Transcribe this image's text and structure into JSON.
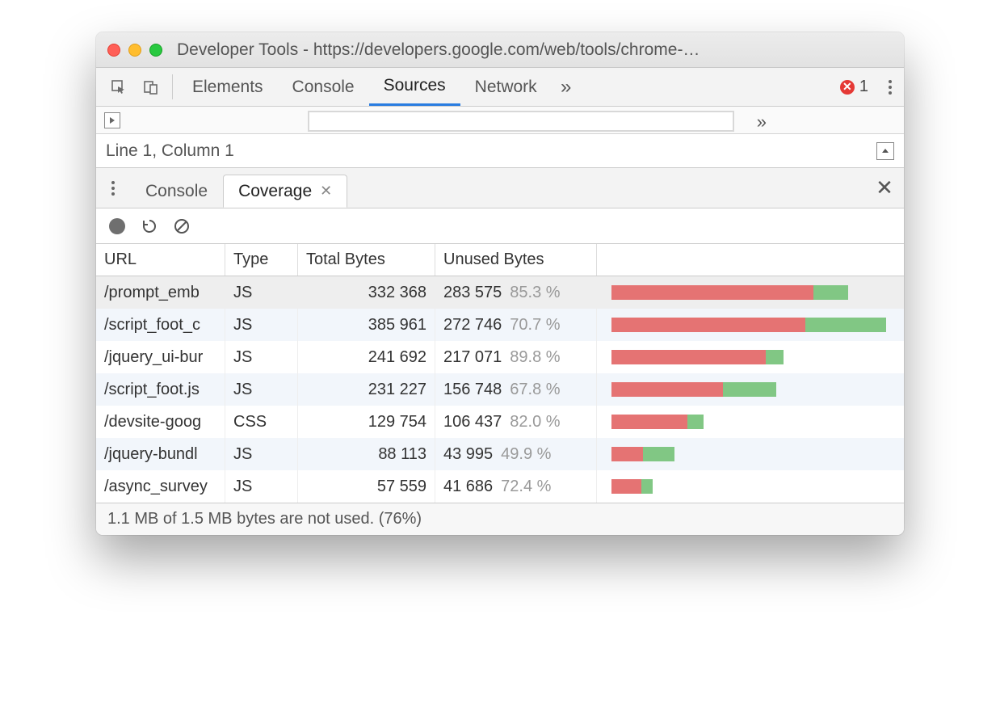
{
  "window": {
    "title": "Developer Tools - https://developers.google.com/web/tools/chrome-…"
  },
  "toolbar": {
    "tabs": [
      "Elements",
      "Console",
      "Sources",
      "Network"
    ],
    "active_tab": "Sources",
    "overflow_glyph": "»",
    "error_count": "1"
  },
  "source_status": {
    "position": "Line 1, Column 1"
  },
  "drawer": {
    "tabs": [
      {
        "label": "Console",
        "active": false
      },
      {
        "label": "Coverage",
        "active": true
      }
    ]
  },
  "coverage": {
    "headers": {
      "url": "URL",
      "type": "Type",
      "total": "Total Bytes",
      "unused": "Unused Bytes"
    },
    "footer": "1.1 MB of 1.5 MB bytes are not used. (76%)",
    "max_total_bytes": 385961,
    "rows": [
      {
        "url": "/prompt_emb",
        "type": "JS",
        "total": "332 368",
        "unused": "283 575",
        "pct": "85.3 %",
        "total_n": 332368,
        "pct_n": 85.3,
        "selected": true
      },
      {
        "url": "/script_foot_c",
        "type": "JS",
        "total": "385 961",
        "unused": "272 746",
        "pct": "70.7 %",
        "total_n": 385961,
        "pct_n": 70.7,
        "selected": false
      },
      {
        "url": "/jquery_ui-bur",
        "type": "JS",
        "total": "241 692",
        "unused": "217 071",
        "pct": "89.8 %",
        "total_n": 241692,
        "pct_n": 89.8,
        "selected": false
      },
      {
        "url": "/script_foot.js",
        "type": "JS",
        "total": "231 227",
        "unused": "156 748",
        "pct": "67.8 %",
        "total_n": 231227,
        "pct_n": 67.8,
        "selected": false
      },
      {
        "url": "/devsite-goog",
        "type": "CSS",
        "total": "129 754",
        "unused": "106 437",
        "pct": "82.0 %",
        "total_n": 129754,
        "pct_n": 82.0,
        "selected": false
      },
      {
        "url": "/jquery-bundl",
        "type": "JS",
        "total": "88 113",
        "unused": "43 995",
        "pct": "49.9 %",
        "total_n": 88113,
        "pct_n": 49.9,
        "selected": false
      },
      {
        "url": "/async_survey",
        "type": "JS",
        "total": "57 559",
        "unused": "41 686",
        "pct": "72.4 %",
        "total_n": 57559,
        "pct_n": 72.4,
        "selected": false
      }
    ]
  }
}
